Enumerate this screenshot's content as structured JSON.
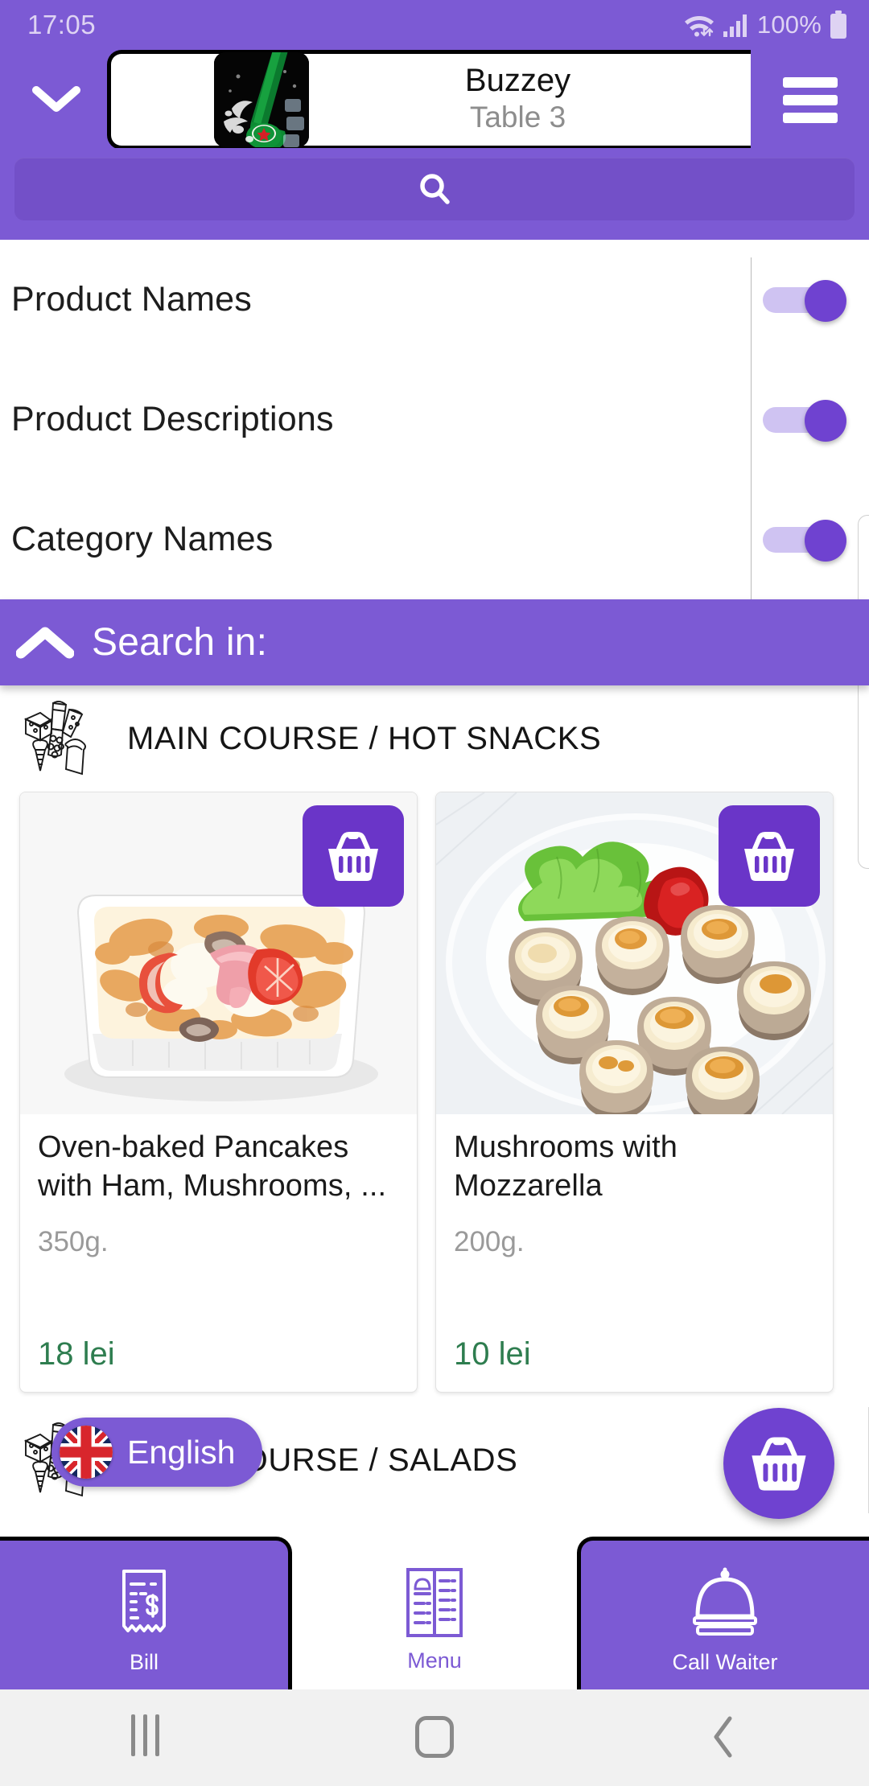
{
  "status_bar": {
    "time": "17:05",
    "battery_percent": "100%",
    "wifi_icon": "wifi-icon",
    "signal_icon": "cellular-signal-icon",
    "battery_icon": "battery-full-icon"
  },
  "header": {
    "collapse_icon": "chevron-down-icon",
    "logo_alt": "heineken-beer-bottle-logo",
    "title": "Buzzey",
    "subtitle": "Table 3",
    "menu_icon": "hamburger-menu-icon"
  },
  "search": {
    "icon": "search-icon",
    "placeholder": ""
  },
  "search_options": {
    "items": [
      {
        "label": "Product Names",
        "enabled": true
      },
      {
        "label": "Product Descriptions",
        "enabled": true
      },
      {
        "label": "Category Names",
        "enabled": true
      }
    ]
  },
  "search_in_bar": {
    "label": "Search in:",
    "icon": "chevron-up-icon"
  },
  "categories": [
    {
      "icon": "assorted-food-line-icon",
      "title": "MAIN COURSE / HOT SNACKS",
      "products": [
        {
          "name": "Oven-baked Pancakes with Ham, Mushrooms, ...",
          "weight": "350g.",
          "price": "18 lei",
          "image_alt": "oven-baked-casserole-with-ham-tomato",
          "add_icon": "shopping-basket-icon"
        },
        {
          "name": "Mushrooms with Mozzarella",
          "weight": "200g.",
          "price": "10 lei",
          "image_alt": "stuffed-mushrooms-on-white-plate",
          "add_icon": "shopping-basket-icon"
        }
      ]
    },
    {
      "icon": "assorted-food-line-icon",
      "title": "MAIN COURSE / SALADS",
      "products": []
    }
  ],
  "language_selector": {
    "label": "English",
    "flag": "union-jack-flag-icon"
  },
  "cart_fab": {
    "icon": "shopping-basket-icon"
  },
  "bottom_nav": {
    "items": [
      {
        "label": "Bill",
        "icon": "receipt-dollar-icon",
        "style": "filled"
      },
      {
        "label": "Menu",
        "icon": "menu-card-icon",
        "style": "plain"
      },
      {
        "label": "Call Waiter",
        "icon": "service-bell-icon",
        "style": "filled"
      }
    ]
  },
  "android_nav": {
    "recent_icon": "recent-apps-icon",
    "home_icon": "home-icon",
    "back_icon": "back-chevron-icon"
  },
  "colors": {
    "brand_purple": "#7c5ad4",
    "deep_purple": "#6a35c8",
    "search_purple": "#7350c8",
    "price_green": "#2e7d4f",
    "toggle_track": "#cfc3f2"
  }
}
